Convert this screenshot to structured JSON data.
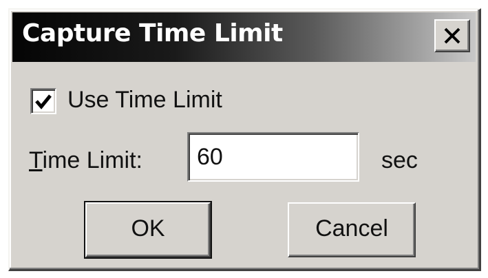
{
  "window": {
    "title": "Capture Time Limit",
    "close_icon": "close-icon"
  },
  "options": {
    "use_time_limit_label": "Use Time Limit",
    "use_time_limit_checked": true
  },
  "time_limit": {
    "label_mnemonic": "T",
    "label_rest": "ime Limit:",
    "value": "60",
    "unit": "sec"
  },
  "buttons": {
    "ok_label": "OK",
    "cancel_label": "Cancel"
  },
  "colors": {
    "dialog_face": "#d6d3ce",
    "title_gradient_start": "#050505",
    "title_gradient_end": "#c8c8c8",
    "title_text": "#ffffff"
  }
}
